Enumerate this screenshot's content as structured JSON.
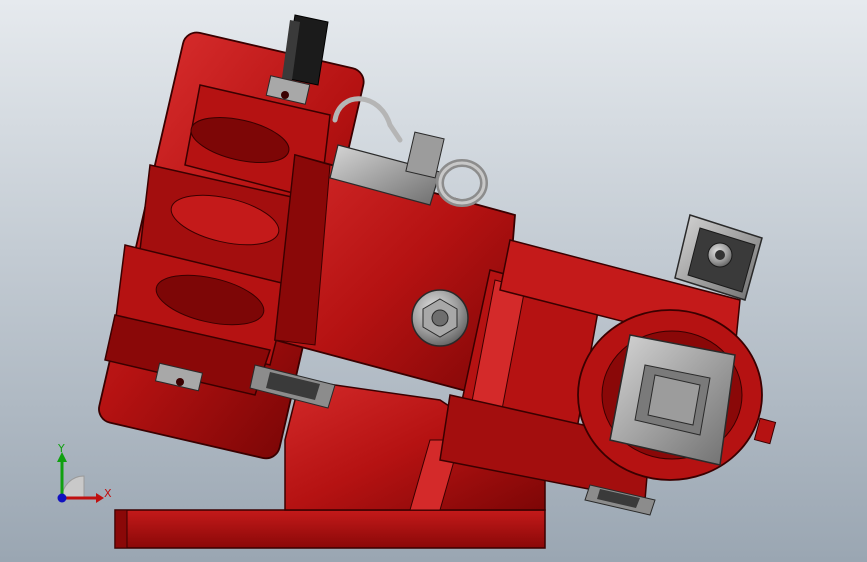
{
  "viewport": {
    "model": "red-mechanical-assembly",
    "colors": {
      "background_top": "#e6eaee",
      "background_bottom": "#9aa6b2",
      "body_red": "#b51212",
      "body_red_dark": "#7d0606",
      "body_red_light": "#d42a2a",
      "edge": "#3a0000",
      "metal": "#9c9c9c",
      "metal_dark": "#5e5e5e",
      "connector_black": "#1b1b1b"
    }
  },
  "triad": {
    "x_label": "X",
    "y_label": "Y",
    "x_color": "#c01010",
    "y_color": "#10a010",
    "z_color": "#1010c0"
  }
}
